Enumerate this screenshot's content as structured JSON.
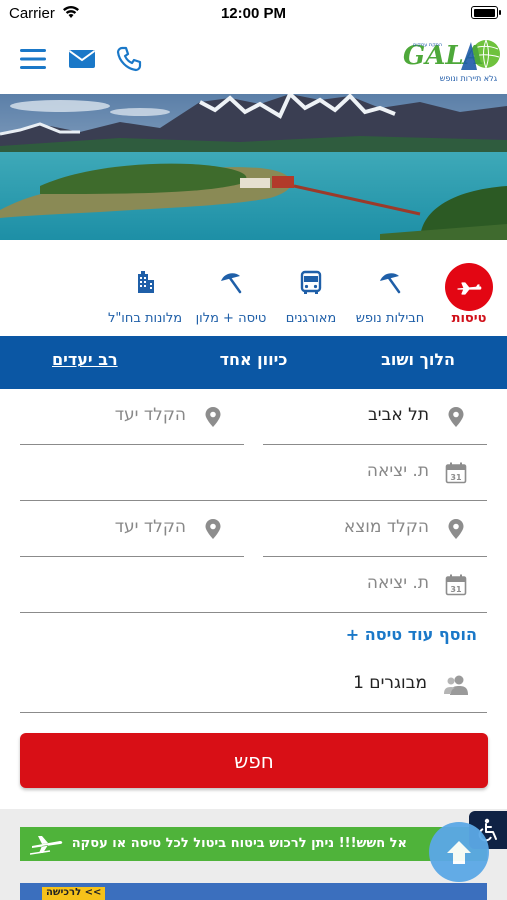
{
  "status_bar": {
    "carrier": "Carrier",
    "time": "12:00 PM"
  },
  "header": {
    "logo_text": "גלא תיירות ונופש",
    "logo_tagline": "הפקת עסקים",
    "icons": [
      "menu-icon",
      "mail-icon",
      "phone-icon"
    ]
  },
  "categories": [
    {
      "label": "טיסות",
      "icon": "airplane-icon",
      "active": true
    },
    {
      "label": "חבילות נופש",
      "icon": "umbrella-icon",
      "active": false
    },
    {
      "label": "מאורגנים",
      "icon": "bus-icon",
      "active": false
    },
    {
      "label": "טיסה + מלון",
      "icon": "umbrella-icon",
      "active": false
    },
    {
      "label": "מלונות בחו\"ל",
      "icon": "hotel-icon",
      "active": false
    }
  ],
  "trip_types": {
    "round_trip": "הלוך ושוב",
    "one_way": "כיוון אחד",
    "multi_city": "רב יעדים"
  },
  "form": {
    "origin_1": "תל אביב",
    "dest_1_placeholder": "הקלד יעד",
    "date_1_placeholder": "ת. יציאה",
    "origin_2_placeholder": "הקלד מוצא",
    "dest_2_placeholder": "הקלד יעד",
    "date_2_placeholder": "ת. יציאה",
    "add_flight": "+ הוסף עוד טיסה",
    "passengers": "1 מבוגרים",
    "search_label": "חפש"
  },
  "banners": {
    "insurance": "אל חשש!!! ניתן לרכוש ביטוח ביטול לכל טיסה או עסקה",
    "promo_tag": "לרכישה <<"
  },
  "colors": {
    "brand_blue": "#0b57a4",
    "accent_red": "#d80f16",
    "link_blue": "#1a78c8",
    "banner_green": "#4fb33a"
  }
}
